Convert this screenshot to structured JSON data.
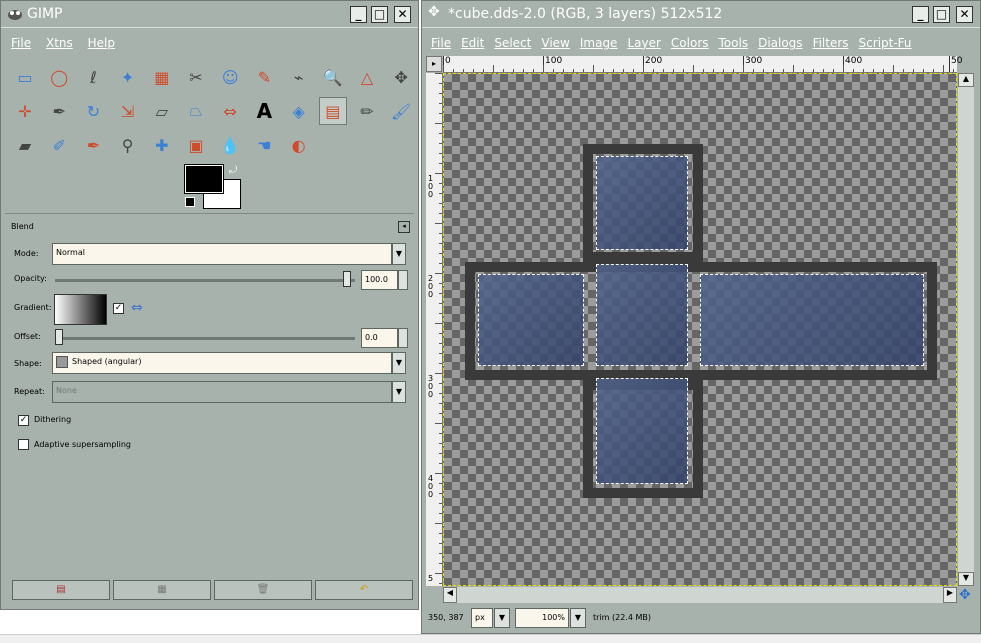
{
  "toolbox": {
    "title": "GIMP",
    "menu": [
      "File",
      "Xtns",
      "Help"
    ],
    "tools_row1": [
      "rect-select-icon",
      "ellipse-select-icon",
      "lasso-icon",
      "fuzzy-select-icon",
      "color-select-icon",
      "scissors-icon",
      "foreground-select-icon",
      "paths-icon",
      "color-picker-icon",
      "zoom-icon",
      "measure-icon",
      "move-icon"
    ],
    "tools_row2": [
      "align-icon",
      "crop-icon",
      "rotate-icon",
      "scale-icon",
      "shear-icon",
      "perspective-icon",
      "flip-icon",
      "text-icon",
      "bucket-fill-icon",
      "blend-icon",
      "pencil-icon",
      "paintbrush-icon"
    ],
    "tools_row3": [
      "eraser-icon",
      "airbrush-icon",
      "ink-icon",
      "clone-icon",
      "heal-icon",
      "perspective-clone-icon",
      "blur-icon",
      "smudge-icon",
      "dodge-burn-icon"
    ],
    "options": {
      "panel_title": "Blend",
      "mode_label": "Mode:",
      "mode_value": "Normal",
      "opacity_label": "Opacity:",
      "opacity_value": "100.0",
      "opacity_fraction": 1.0,
      "gradient_label": "Gradient:",
      "offset_label": "Offset:",
      "offset_value": "0.0",
      "offset_fraction": 0.0,
      "shape_label": "Shape:",
      "shape_value": "Shaped (angular)",
      "repeat_label": "Repeat:",
      "repeat_value": "None",
      "dithering_label": "Dithering",
      "dithering_checked": true,
      "adaptive_label": "Adaptive supersampling",
      "adaptive_checked": false
    }
  },
  "image_window": {
    "title": "*cube.dds-2.0 (RGB, 3 layers) 512x512",
    "menu": [
      "File",
      "Edit",
      "Select",
      "View",
      "Image",
      "Layer",
      "Colors",
      "Tools",
      "Dialogs",
      "Filters",
      "Script-Fu"
    ],
    "ruler_h": [
      "0",
      "100",
      "200",
      "300",
      "400",
      "50"
    ],
    "ruler_v": [
      "1\n0\n0",
      "2\n0\n0",
      "3\n0\n0",
      "4\n0\n0",
      "5"
    ],
    "status": {
      "coords": "350, 387",
      "unit": "px",
      "zoom": "100%",
      "message": "trim (22.4 MB)"
    }
  }
}
